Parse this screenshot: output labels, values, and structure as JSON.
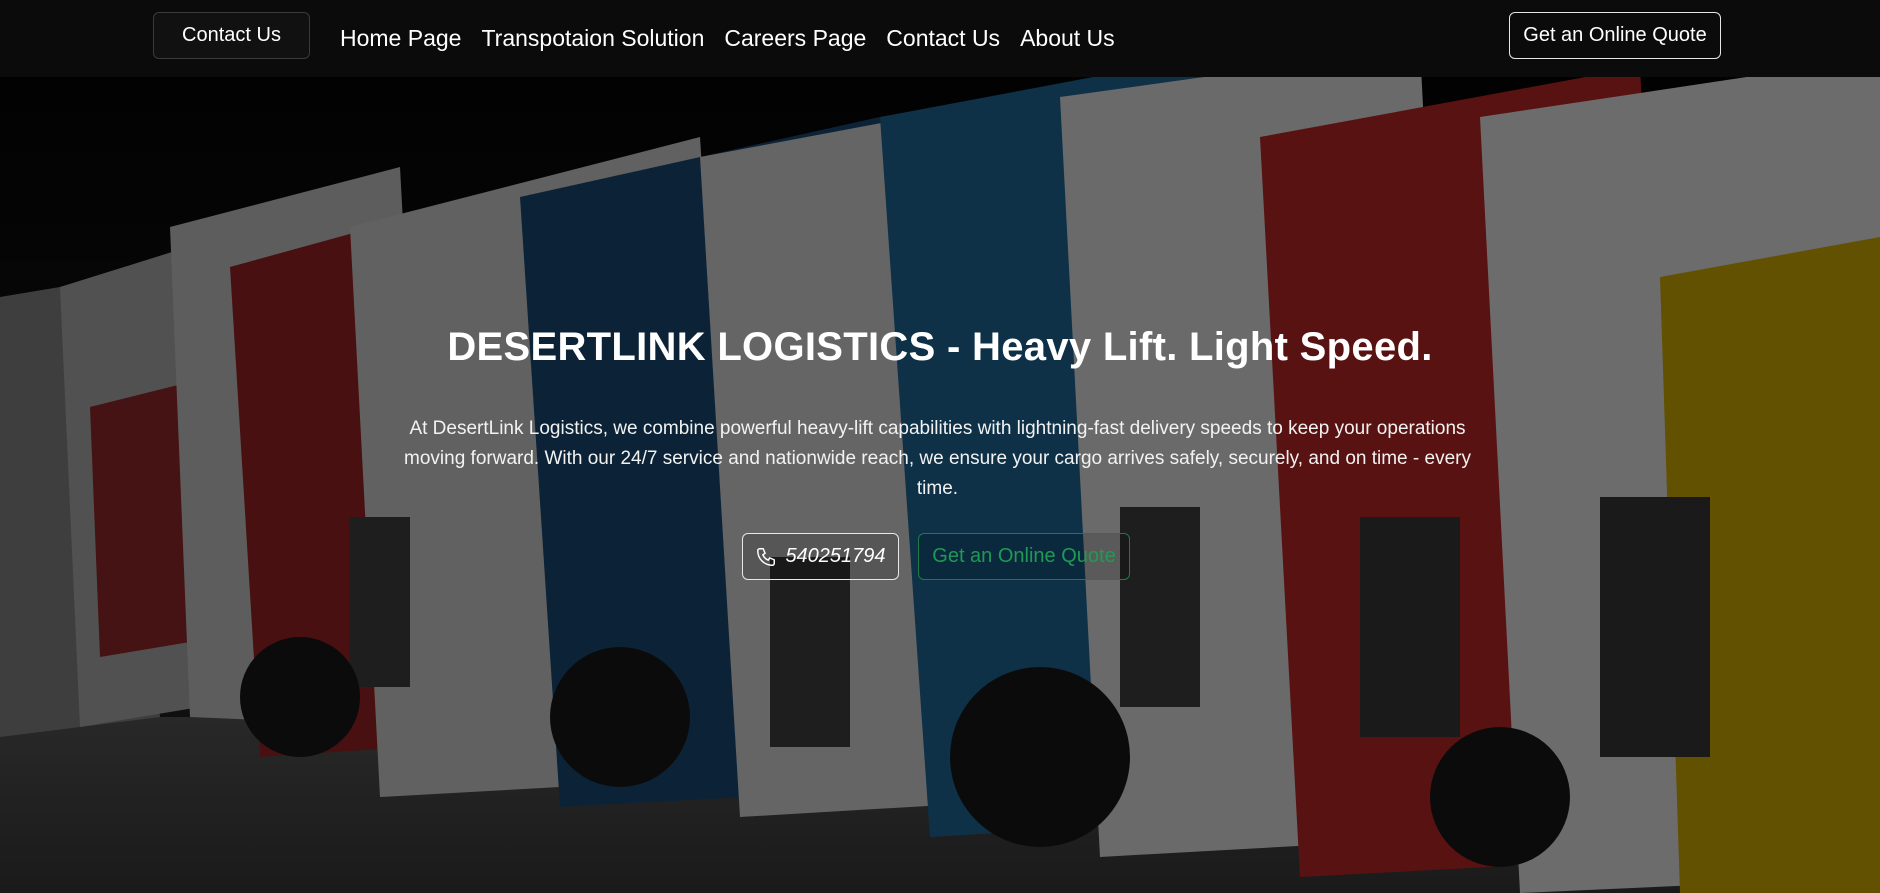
{
  "nav": {
    "contact_button": "Contact Us",
    "links": [
      "Home Page",
      "Transpotaion Solution",
      "Careers Page",
      "Contact Us",
      "About Us"
    ],
    "quote_button": "Get an Online Quote"
  },
  "hero": {
    "title": "DESERTLINK LOGISTICS - Heavy Lift. Light Speed.",
    "description": "At DesertLink Logistics, we combine powerful heavy-lift capabilities with lightning-fast delivery speeds to keep your operations moving forward. With our 24/7 service and nationwide reach, we ensure your cargo arrives safely, securely, and on time - every time.",
    "phone": "540251794",
    "phone_icon": "phone-icon",
    "quote_button": "Get an Online Quote",
    "background": "row of parked semi-trucks"
  },
  "colors": {
    "nav_bg": "#0b0b0b",
    "accent_green": "#1f9a55",
    "text": "#ffffff"
  }
}
